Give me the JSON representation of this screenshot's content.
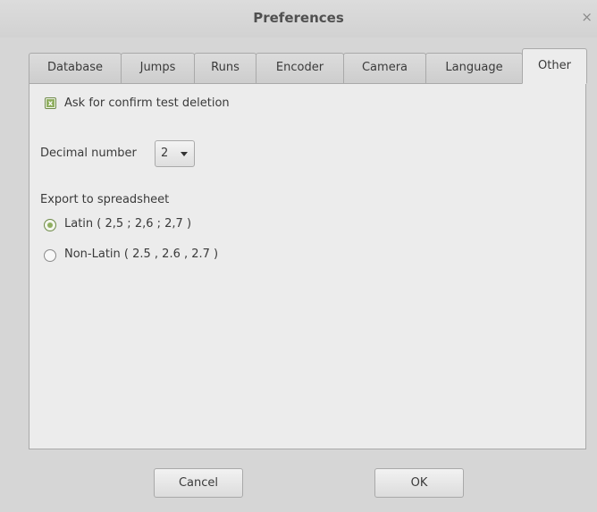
{
  "window": {
    "title": "Preferences",
    "close_glyph": "×"
  },
  "tabs": [
    {
      "label": "Database",
      "active": false
    },
    {
      "label": "Jumps",
      "active": false
    },
    {
      "label": "Runs",
      "active": false
    },
    {
      "label": "Encoder",
      "active": false
    },
    {
      "label": "Camera",
      "active": false
    },
    {
      "label": "Language",
      "active": false
    },
    {
      "label": "Other",
      "active": true
    }
  ],
  "other": {
    "confirm_deletion": {
      "label": "Ask for confirm test deletion",
      "checked": true,
      "check_glyph": "x"
    },
    "decimal": {
      "label": "Decimal number",
      "value": "2"
    },
    "export": {
      "label": "Export to spreadsheet",
      "options": [
        {
          "label": "Latin  ( 2,5 ; 2,6 ; 2,7 )",
          "selected": true
        },
        {
          "label": "Non-Latin  ( 2.5 , 2.6 , 2.7 )",
          "selected": false
        }
      ]
    }
  },
  "buttons": {
    "cancel": "Cancel",
    "ok": "OK"
  },
  "colors": {
    "accent_green": "#8fae5f",
    "window_bg": "#d6d6d6",
    "panel_bg": "#ececec"
  }
}
